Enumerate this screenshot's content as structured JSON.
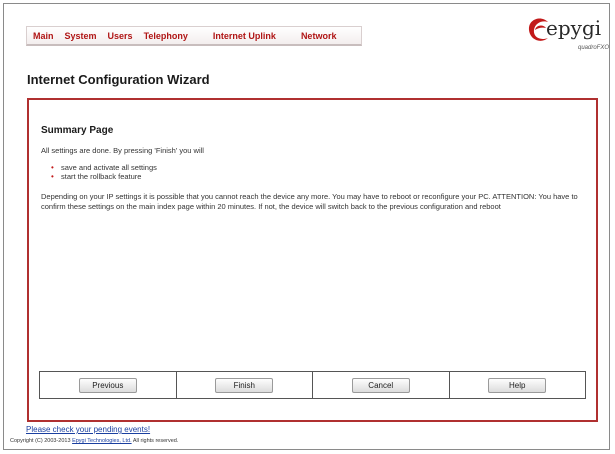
{
  "nav": {
    "items": [
      "Main",
      "System",
      "Users",
      "Telephony",
      "Internet Uplink",
      "Network"
    ]
  },
  "logo": {
    "brand": "epygi",
    "product": "quadroFXO"
  },
  "page_title": "Internet Configuration Wizard",
  "summary": {
    "title": "Summary Page",
    "intro": "All settings are done. By pressing 'Finish' you will",
    "bullets": [
      "save and activate all settings",
      "start the rollback feature"
    ],
    "paragraph": "Depending on your IP settings it is possible that you cannot reach the device any more. You may have to reboot or reconfigure your PC. ATTENTION: You have to confirm these settings on the main index page within 20 minutes. If not, the device will switch back to the previous configuration and reboot"
  },
  "buttons": {
    "previous": "Previous",
    "finish": "Finish",
    "cancel": "Cancel",
    "help": "Help"
  },
  "footer": {
    "events_link": "Please check your pending events!",
    "copyright_prefix": "Copyright (C) 2003-2013",
    "company_link": "Epygi Technologies, Ltd.",
    "copyright_suffix": "All rights reserved."
  },
  "colors": {
    "accent": "#b01515",
    "panel_border": "#b03030",
    "link": "#1a3fa0"
  }
}
